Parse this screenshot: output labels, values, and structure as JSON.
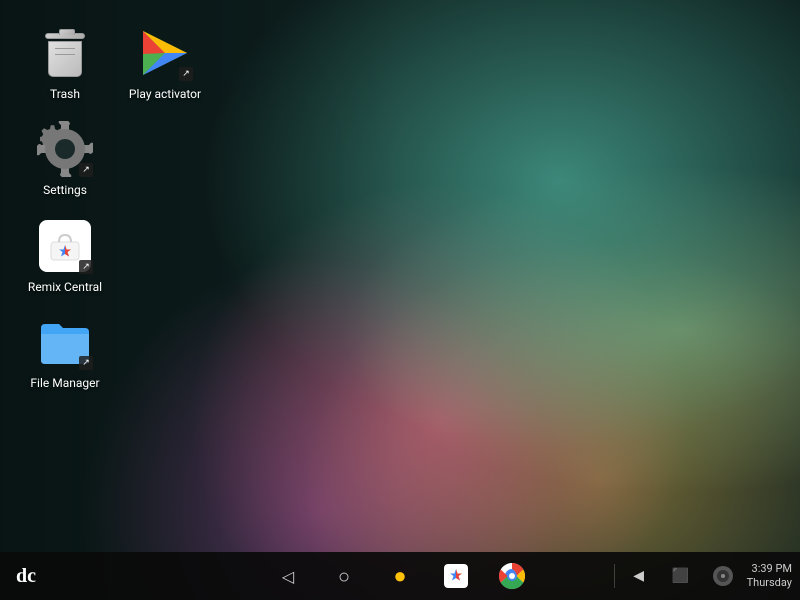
{
  "desktop": {
    "icons": [
      {
        "id": "trash",
        "label": "Trash",
        "type": "trash",
        "hasShortcut": false
      },
      {
        "id": "play-activator",
        "label": "Play activator",
        "type": "play",
        "hasShortcut": true
      },
      {
        "id": "settings",
        "label": "Settings",
        "type": "settings",
        "hasShortcut": true
      },
      {
        "id": "remix-central",
        "label": "Remix Central",
        "type": "remix",
        "hasShortcut": true
      },
      {
        "id": "file-manager",
        "label": "File Manager",
        "type": "folder",
        "hasShortcut": true
      }
    ]
  },
  "taskbar": {
    "remix_logo": "dc",
    "nav": {
      "back_label": "◁",
      "home_label": "○",
      "recents_label": "◉"
    },
    "apps": {
      "store_label": "★",
      "chrome_label": "●"
    },
    "tray": {
      "time": "3:39 PM",
      "day": "Thursday"
    }
  }
}
